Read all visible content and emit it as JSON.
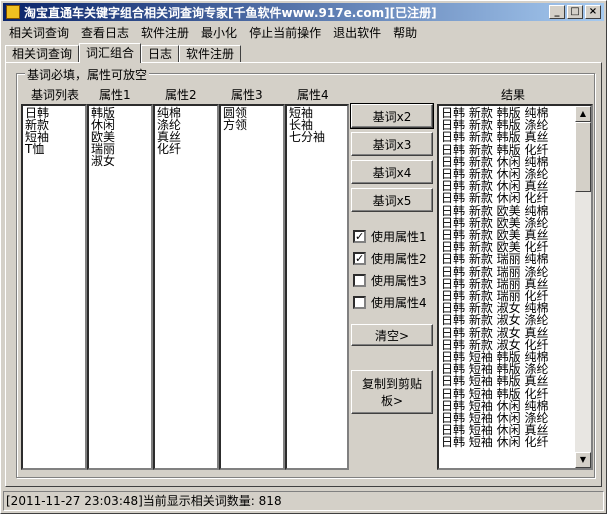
{
  "window": {
    "title": "淘宝直通车关键字组合相关词查询专家[千鱼软件www.917e.com][已注册]"
  },
  "menu": [
    "相关词查询",
    "查看日志",
    "软件注册",
    "最小化",
    "停止当前操作",
    "退出软件",
    "帮助"
  ],
  "tabs": [
    "相关词查询",
    "词汇组合",
    "日志",
    "软件注册"
  ],
  "group": {
    "title": "基词必填，属性可放空",
    "headers": [
      "基词列表",
      "属性1",
      "属性2",
      "属性3",
      "属性4",
      "结果"
    ]
  },
  "lists": {
    "base": [
      "日韩",
      "新款",
      "短袖",
      "T恤"
    ],
    "attr1": [
      "韩版",
      "休闲",
      "欧美",
      "瑞丽",
      "淑女"
    ],
    "attr2": [
      "纯棉",
      "涤纶",
      "真丝",
      "化纤"
    ],
    "attr3": [
      "圆领",
      "方领"
    ],
    "attr4": [
      "短袖",
      "长袖",
      "七分袖"
    ]
  },
  "buttons": {
    "x2": "基词x2",
    "x3": "基词x3",
    "x4": "基词x4",
    "x5": "基词x5",
    "clear": "清空>",
    "copy_line1": "复制到剪贴",
    "copy_line2": "板>"
  },
  "checkboxes": [
    {
      "label": "使用属性1",
      "checked": true
    },
    {
      "label": "使用属性2",
      "checked": true
    },
    {
      "label": "使用属性3",
      "checked": false
    },
    {
      "label": "使用属性4",
      "checked": false
    }
  ],
  "results": [
    "日韩 新款 韩版 纯棉",
    "日韩 新款 韩版 涤纶",
    "日韩 新款 韩版 真丝",
    "日韩 新款 韩版 化纤",
    "日韩 新款 休闲 纯棉",
    "日韩 新款 休闲 涤纶",
    "日韩 新款 休闲 真丝",
    "日韩 新款 休闲 化纤",
    "日韩 新款 欧美 纯棉",
    "日韩 新款 欧美 涤纶",
    "日韩 新款 欧美 真丝",
    "日韩 新款 欧美 化纤",
    "日韩 新款 瑞丽 纯棉",
    "日韩 新款 瑞丽 涤纶",
    "日韩 新款 瑞丽 真丝",
    "日韩 新款 瑞丽 化纤",
    "日韩 新款 淑女 纯棉",
    "日韩 新款 淑女 涤纶",
    "日韩 新款 淑女 真丝",
    "日韩 新款 淑女 化纤",
    "日韩 短袖 韩版 纯棉",
    "日韩 短袖 韩版 涤纶",
    "日韩 短袖 韩版 真丝",
    "日韩 短袖 韩版 化纤",
    "日韩 短袖 休闲 纯棉",
    "日韩 短袖 休闲 涤纶",
    "日韩 短袖 休闲 真丝",
    "日韩 短袖 休闲 化纤"
  ],
  "status": "[2011-11-27 23:03:48]当前显示相关词数量: 818"
}
